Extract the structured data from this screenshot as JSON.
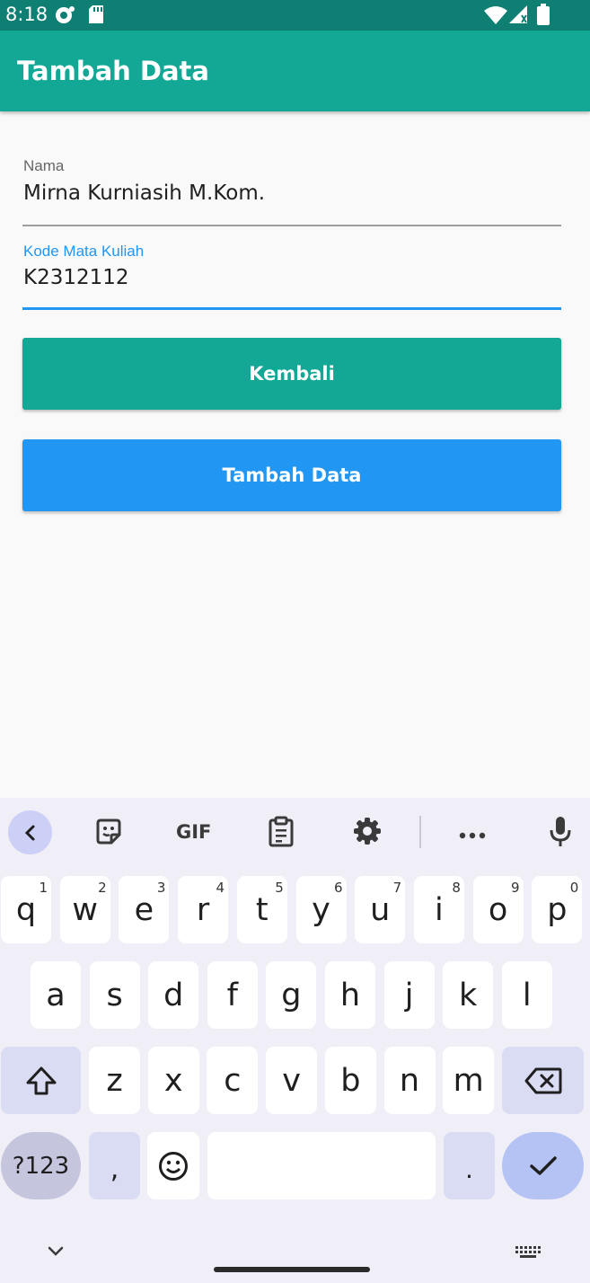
{
  "status_bar": {
    "time": "8:18",
    "icons": [
      "notification-icon",
      "sd-card-icon",
      "wifi-icon",
      "signal-icon",
      "battery-icon"
    ]
  },
  "app_bar": {
    "title": "Tambah Data"
  },
  "form": {
    "nama": {
      "label": "Nama",
      "value": "Mirna Kurniasih M.Kom."
    },
    "kode": {
      "label": "Kode Mata Kuliah",
      "value": "K2312112"
    }
  },
  "buttons": {
    "kembali": "Kembali",
    "tambah": "Tambah Data"
  },
  "colors": {
    "status_bar": "#0f7f73",
    "app_bar": "#13a896",
    "kembali_button": "#13a896",
    "tambah_button": "#2196f3",
    "focused_field": "#2196f3"
  },
  "keyboard": {
    "toolbar": [
      "back-icon",
      "sticker-icon",
      "gif-icon",
      "clipboard-icon",
      "settings-icon",
      "more-icon",
      "mic-icon"
    ],
    "gif_label": "GIF",
    "row1": [
      {
        "key": "q",
        "hint": "1"
      },
      {
        "key": "w",
        "hint": "2"
      },
      {
        "key": "e",
        "hint": "3"
      },
      {
        "key": "r",
        "hint": "4"
      },
      {
        "key": "t",
        "hint": "5"
      },
      {
        "key": "y",
        "hint": "6"
      },
      {
        "key": "u",
        "hint": "7"
      },
      {
        "key": "i",
        "hint": "8"
      },
      {
        "key": "o",
        "hint": "9"
      },
      {
        "key": "p",
        "hint": "0"
      }
    ],
    "row2": [
      "a",
      "s",
      "d",
      "f",
      "g",
      "h",
      "j",
      "k",
      "l"
    ],
    "row3": [
      "z",
      "x",
      "c",
      "v",
      "b",
      "n",
      "m"
    ],
    "row4": {
      "symbols": "?123",
      "comma": ",",
      "period": "."
    }
  }
}
